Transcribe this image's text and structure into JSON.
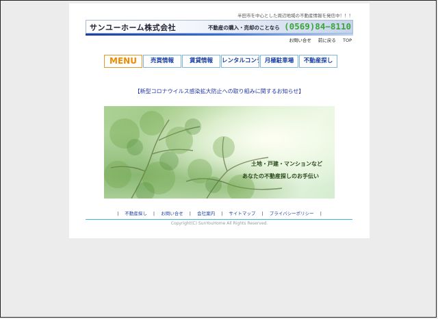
{
  "header": {
    "tagline": "半田市を中心とした周辺地域の不動産情報を発信中！！！",
    "company": "サンユーホーム株式会社",
    "slogan": "不動産の購入・売却のことなら",
    "phone": "(0569)84−8110"
  },
  "util_nav": [
    "お問い合せ",
    "前に戻る",
    "TOP"
  ],
  "menu": {
    "title": "MENU",
    "items": [
      "売買情報",
      "賃貸情報",
      "レンタルコンテナ",
      "月極駐車場",
      "不動産探し"
    ]
  },
  "notice": "【新型コロナウイルス感染拡大防止への取り組みに関するお知らせ】",
  "hero": {
    "line1": "土地・戸建・マンションなど",
    "line2": "あなたの不動産探しのお手伝い"
  },
  "footer": {
    "links": [
      "不動産探し",
      "お問い合せ",
      "会社案内",
      "サイトマップ",
      "プライバシーポリシー"
    ],
    "copyright": "Copyright(C) SunYouHome All Rights Reserved."
  },
  "colors": {
    "menu_title": "#f08a00",
    "menu_text": "#1a3fa0",
    "phone": "#3aa535",
    "notice": "#2233aa",
    "footer_line": "#39b7d6"
  }
}
